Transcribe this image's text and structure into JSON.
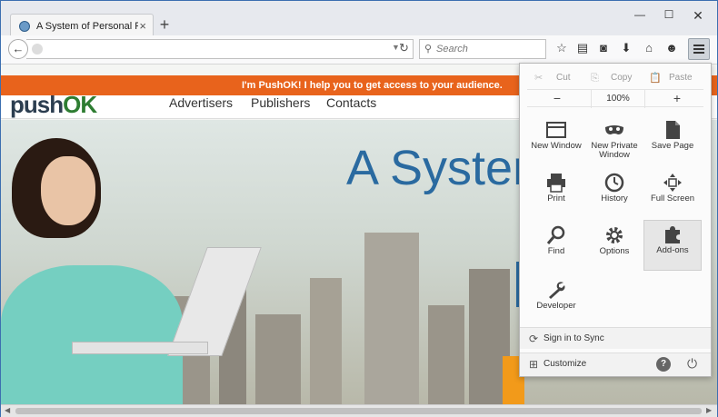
{
  "tab": {
    "title": "A System of Personal Rec..."
  },
  "window_controls": {
    "minimize": "—",
    "maximize": "☐",
    "close": "✕"
  },
  "search": {
    "placeholder": "Search"
  },
  "page": {
    "notice": "I'm PushOK! I help you to get access to your audience.",
    "logo_prefix": "push",
    "logo_suffix": "OK",
    "nav": [
      "Advertisers",
      "Publishers",
      "Contacts"
    ],
    "hero_title": "A System"
  },
  "menu": {
    "edit": {
      "cut": "Cut",
      "copy": "Copy",
      "paste": "Paste"
    },
    "zoom": {
      "minus": "−",
      "value": "100%",
      "plus": "+"
    },
    "items": [
      {
        "label": "New Window",
        "icon": "new-window-icon"
      },
      {
        "label": "New Private Window",
        "icon": "mask-icon"
      },
      {
        "label": "Save Page",
        "icon": "page-icon"
      },
      {
        "label": "Print",
        "icon": "printer-icon"
      },
      {
        "label": "History",
        "icon": "clock-icon"
      },
      {
        "label": "Full Screen",
        "icon": "fullscreen-icon"
      },
      {
        "label": "Find",
        "icon": "magnifier-icon"
      },
      {
        "label": "Options",
        "icon": "gear-icon"
      },
      {
        "label": "Add-ons",
        "icon": "puzzle-icon"
      },
      {
        "label": "Developer",
        "icon": "wrench-icon"
      }
    ],
    "sync": "Sign in to Sync",
    "customize": "Customize"
  },
  "colors": {
    "accent_orange": "#e8631c",
    "hero_blue": "#2a6aa0",
    "tab_bg": "#e7e9ee"
  }
}
